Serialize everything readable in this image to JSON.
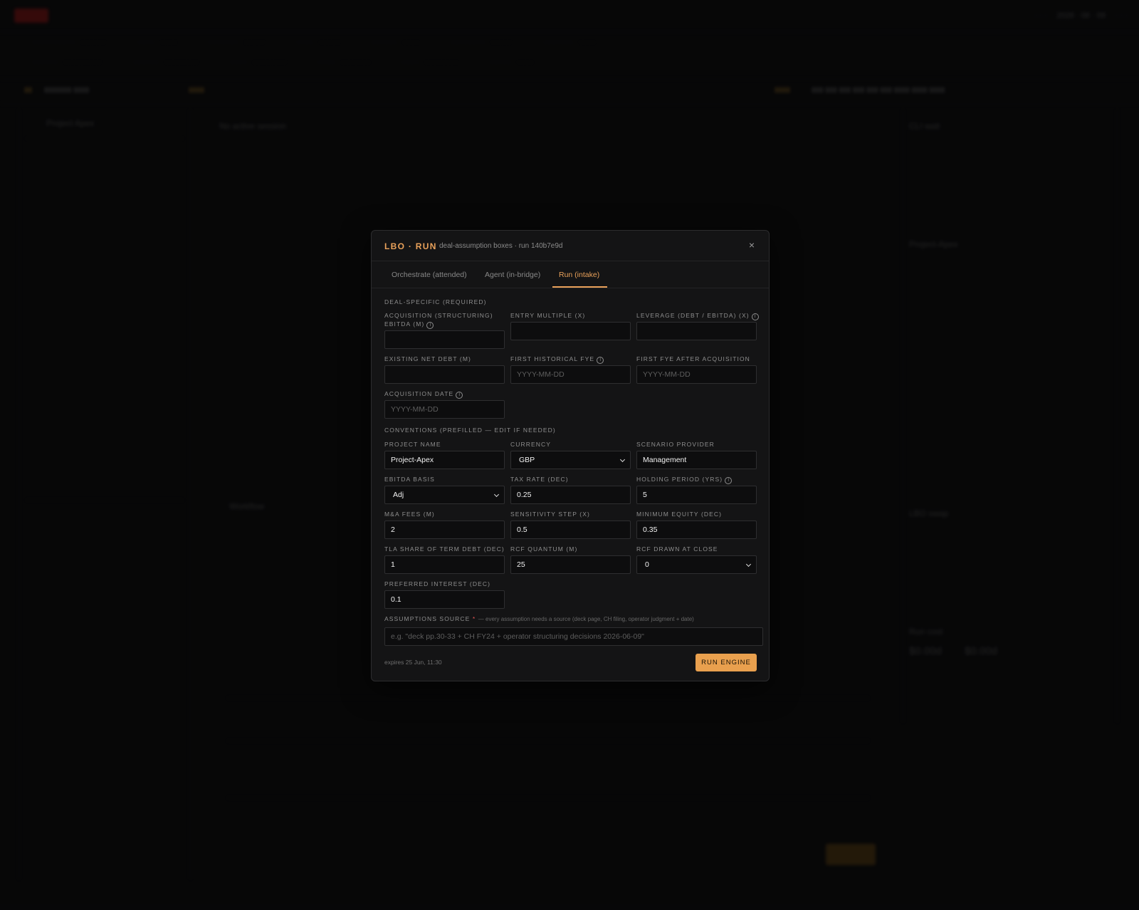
{
  "modal": {
    "title": "LBO · RUN",
    "subtitle": "deal-assumption boxes · run 140b7e9d",
    "close_label": "×",
    "tabs": [
      {
        "label": "Orchestrate (attended)"
      },
      {
        "label": "Agent (in-bridge)"
      },
      {
        "label": "Run (intake)",
        "active": true
      }
    ],
    "deal_section": "DEAL-SPECIFIC (REQUIRED)",
    "deal_fields": [
      {
        "label": "ACQUISITION (STRUCTURING) EBITDA (M)",
        "info": true,
        "value": ""
      },
      {
        "label": "ENTRY MULTIPLE (X)",
        "value": ""
      },
      {
        "label": "LEVERAGE (DEBT / EBITDA) (X)",
        "info": true,
        "value": ""
      },
      {
        "label": "EXISTING NET DEBT (M)",
        "value": ""
      },
      {
        "label": "FIRST HISTORICAL FYE",
        "info": true,
        "placeholder": "YYYY-MM-DD"
      },
      {
        "label": "FIRST FYE AFTER ACQUISITION",
        "placeholder": "YYYY-MM-DD"
      },
      {
        "label": "ACQUISITION DATE",
        "info": true,
        "placeholder": "YYYY-MM-DD"
      }
    ],
    "conventions_section": "CONVENTIONS (PREFILLED — EDIT IF NEEDED)",
    "convention_fields": [
      {
        "label": "PROJECT NAME",
        "value": "Project-Apex"
      },
      {
        "label": "CURRENCY",
        "value": "GBP",
        "select": true
      },
      {
        "label": "SCENARIO PROVIDER",
        "value": "Management"
      },
      {
        "label": "EBITDA BASIS",
        "value": "Adj",
        "select": true
      },
      {
        "label": "TAX RATE (DEC)",
        "value": "0.25"
      },
      {
        "label": "HOLDING PERIOD (YRS)",
        "info": true,
        "value": "5"
      },
      {
        "label": "M&A FEES (M)",
        "value": "2"
      },
      {
        "label": "SENSITIVITY STEP (X)",
        "value": "0.5"
      },
      {
        "label": "MINIMUM EQUITY (DEC)",
        "value": "0.35"
      },
      {
        "label": "TLA SHARE OF TERM DEBT (DEC)",
        "value": "1"
      },
      {
        "label": "RCF QUANTUM (M)",
        "value": "25"
      },
      {
        "label": "RCF DRAWN AT CLOSE",
        "value": "0",
        "select": true
      },
      {
        "label": "PREFERRED INTEREST (DEC)",
        "value": "0.1"
      }
    ],
    "source_label": "ASSUMPTIONS SOURCE",
    "source_required": "*",
    "source_note": "— every assumption needs a source (deck page, CH filing, operator judgment + date)",
    "source_placeholder": "e.g. \"deck pp.30-33 + CH FY24 + operator structuring decisions 2026-06-09\"",
    "expires": "expires 25 Jun, 11:30",
    "run_button": "RUN ENGINE"
  },
  "background": {
    "left_panel_title": "Project Apex",
    "main_title": "No active session",
    "right_panel_title": "CLI wait",
    "project_name": "Project-Apex",
    "workflow_label": "Workflow",
    "lbo_label": "LBO swap",
    "run_cost": "Run cost",
    "cost_value_a": "$0.00d",
    "cost_value_b": "$0.00d"
  },
  "colors": {
    "accent": "#e9a15a",
    "run_button": "#e9a04e",
    "modal_bg": "#141415",
    "input_bg": "#0d0d0e",
    "required_star": "#e25555"
  }
}
